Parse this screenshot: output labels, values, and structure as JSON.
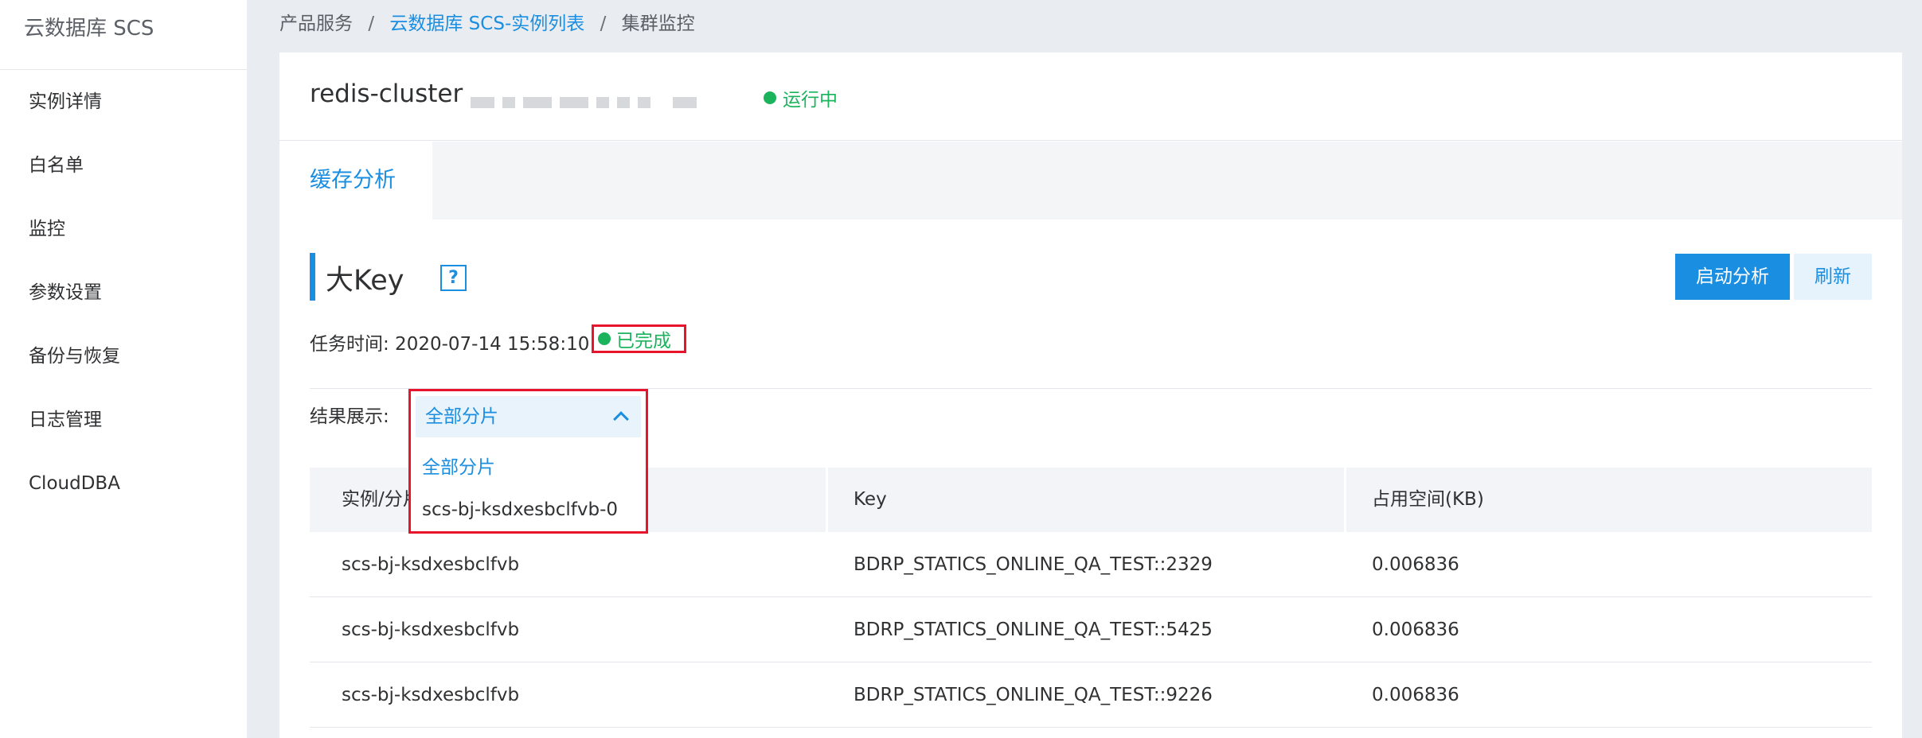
{
  "sidebar": {
    "title": "云数据库 SCS",
    "items": [
      {
        "label": "实例详情"
      },
      {
        "label": "白名单"
      },
      {
        "label": "监控"
      },
      {
        "label": "参数设置"
      },
      {
        "label": "备份与恢复"
      },
      {
        "label": "日志管理"
      },
      {
        "label": "CloudDBA"
      }
    ]
  },
  "breadcrumb": {
    "items": [
      "产品服务",
      "云数据库 SCS-实例列表",
      "集群监控"
    ],
    "separator": "/"
  },
  "instance": {
    "name": "redis-cluster",
    "status": "运行中"
  },
  "tabs": [
    {
      "label": "缓存分析"
    }
  ],
  "section": {
    "title": "大Key",
    "help": "?"
  },
  "buttons": {
    "start_analysis": "启动分析",
    "refresh": "刷新"
  },
  "task": {
    "time_label": "任务时间: 2020-07-14 15:58:10",
    "status": "已完成"
  },
  "result": {
    "label": "结果展示:",
    "selected": "全部分片",
    "options": [
      "全部分片",
      "scs-bj-ksdxesbclfvb-0"
    ]
  },
  "table": {
    "columns": [
      "实例/分片",
      "Key",
      "占用空间(KB)"
    ],
    "rows": [
      [
        "scs-bj-ksdxesbclfvb",
        "BDRP_STATICS_ONLINE_QA_TEST::2329",
        "0.006836"
      ],
      [
        "scs-bj-ksdxesbclfvb",
        "BDRP_STATICS_ONLINE_QA_TEST::5425",
        "0.006836"
      ],
      [
        "scs-bj-ksdxesbclfvb",
        "BDRP_STATICS_ONLINE_QA_TEST::9226",
        "0.006836"
      ]
    ]
  },
  "colors": {
    "accent": "#1a8ee0",
    "success": "#1bb35c",
    "highlight": "#e8142d"
  }
}
